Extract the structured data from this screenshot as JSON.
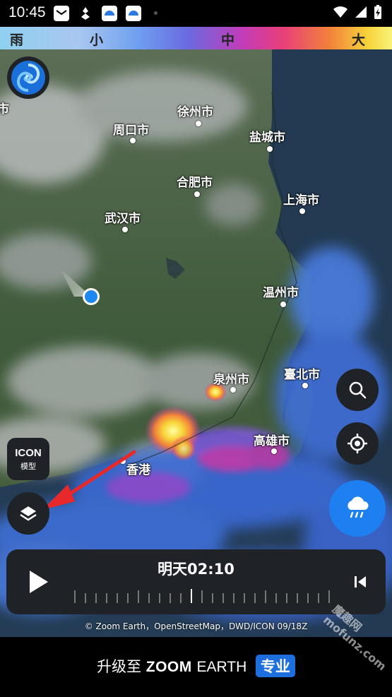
{
  "status_bar": {
    "time": "10:45",
    "icons": [
      "mail-icon",
      "app-icon",
      "weather-app-icon",
      "weather-app-icon",
      "wifi-icon",
      "signal-icon",
      "battery-icon"
    ]
  },
  "legend": {
    "labels": [
      "雨",
      "小",
      "中",
      "大"
    ]
  },
  "map": {
    "cities": [
      "市",
      "徐州市",
      "周口市",
      "盐城市",
      "合肥市",
      "武汉市",
      "上海市",
      "温州市",
      "泉州市",
      "臺北市",
      "高雄市",
      "香港"
    ]
  },
  "controls": {
    "model_label": "ICON",
    "model_sub": "模型"
  },
  "timeline": {
    "time": "明天02:10"
  },
  "attribution": "© Zoom Earth，OpenStreetMap，DWD/ICON 09/18Z",
  "promo": {
    "prefix": "升级至",
    "brand_bold": "ZOOM",
    "brand_light": "EARTH",
    "badge": "专业"
  },
  "colors": {
    "accent_blue": "#1d6fe0",
    "location_blue": "#1e88f0",
    "panel_dark": "#1f2327"
  }
}
